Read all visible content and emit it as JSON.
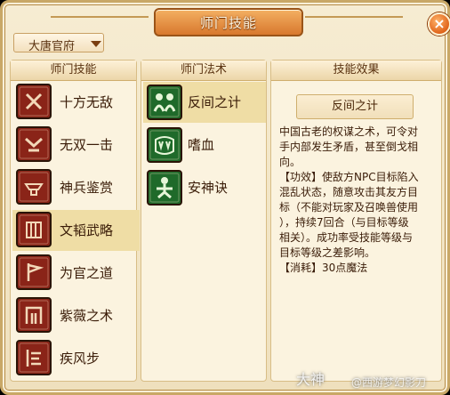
{
  "window": {
    "title": "师门技能",
    "close_label": "×"
  },
  "school_select": {
    "value": "大唐官府"
  },
  "skills_panel": {
    "header": "师门技能",
    "items": [
      {
        "label": "十方无敌",
        "icon": "crossed-blades-icon",
        "selected": false
      },
      {
        "label": "无双一击",
        "icon": "demon-face-icon",
        "selected": false
      },
      {
        "label": "神兵鉴赏",
        "icon": "anvil-icon",
        "selected": false
      },
      {
        "label": "文韬武略",
        "icon": "book-icon",
        "selected": true
      },
      {
        "label": "为官之道",
        "icon": "banner-icon",
        "selected": false
      },
      {
        "label": "紫薇之术",
        "icon": "gate-icon",
        "selected": false
      },
      {
        "label": "疾风步",
        "icon": "wind-step-icon",
        "selected": false
      }
    ]
  },
  "spells_panel": {
    "header": "师门法术",
    "items": [
      {
        "label": "反间之计",
        "icon": "two-figures-icon",
        "selected": true
      },
      {
        "label": "嗜血",
        "icon": "fangs-icon",
        "selected": false
      },
      {
        "label": "安神诀",
        "icon": "meditating-figure-icon",
        "selected": false
      }
    ]
  },
  "effect_panel": {
    "header": "技能效果",
    "name": "反间之计",
    "lines": [
      "中国古老的权谋之术，可令对",
      "手内部发生矛盾，甚至倒戈相",
      "向。",
      "【功效】使敌方NPC目标陷入",
      "混乱状态，随意攻击其友方目",
      "标（不能对玩家及召唤兽使用",
      "），持续7回合（与目标等级",
      "相关）。成功率受技能等级与",
      "目标等级之差影响。",
      "【消耗】30点魔法"
    ]
  },
  "watermark": {
    "big": "大神",
    "small": "@西游梦幻影刀"
  },
  "colors": {
    "skill_icon": "#8a2418",
    "spell_icon": "#1f6a2a",
    "selected_row": "#efdda5"
  }
}
